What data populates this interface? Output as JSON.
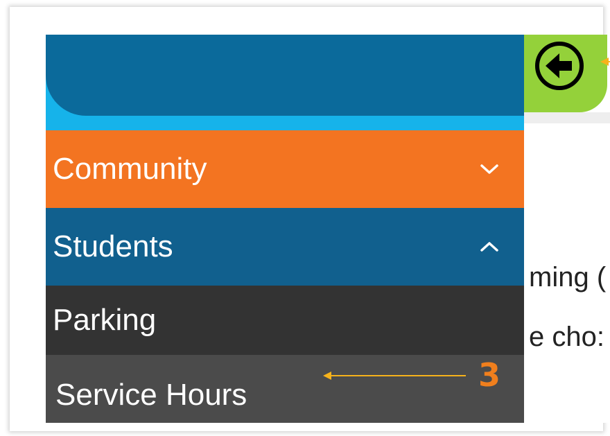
{
  "menu": {
    "items": [
      {
        "label": "Community",
        "state": "collapsed",
        "color": "#f37421"
      },
      {
        "label": "Students",
        "state": "expanded",
        "color": "#11608e"
      }
    ],
    "submenu": [
      {
        "label": "Parking"
      },
      {
        "label": "Service Hours"
      }
    ]
  },
  "header": {
    "back_button_icon": "arrow-left-circle-icon",
    "colors": {
      "primary": "#0b6a9b",
      "accent": "#16b3ea",
      "back_tab": "#94d13a"
    }
  },
  "background_page": {
    "line1": "ming (",
    "line2": "e cho:"
  },
  "annotation": {
    "number": "3",
    "color": "#f6b21b"
  }
}
